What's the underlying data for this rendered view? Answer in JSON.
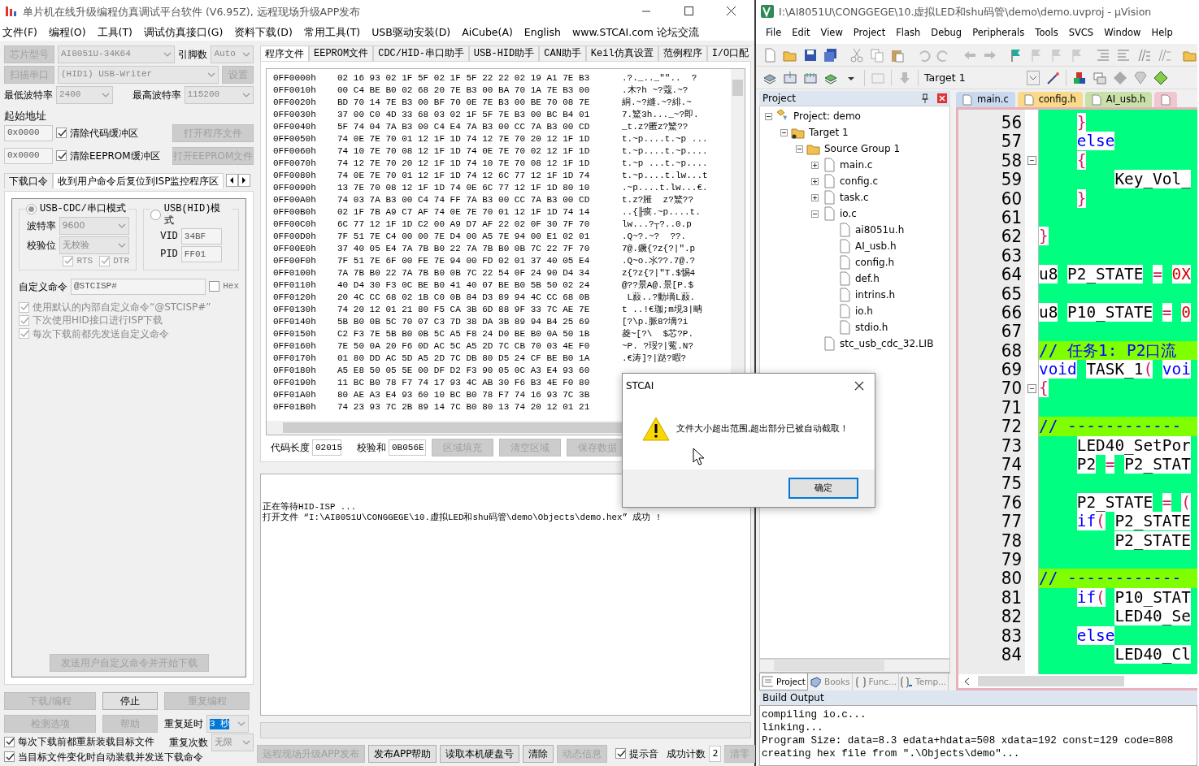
{
  "stc_window": {
    "title": "单片机在线升级编程仿真调试平台软件 (V6.95Z), 远程现场升级APP发布",
    "menu": [
      "文件(F)",
      "编程(O)",
      "工具(T)",
      "调试仿真接口(G)",
      "资料下载(D)",
      "常用工具(T)",
      "USB驱动安装(D)",
      "AiCube(A)",
      "English",
      "www.STCAI.com 论坛交流"
    ],
    "chip": {
      "button": "芯片型号",
      "value": "AI8051U-34K64",
      "pins_label": "引脚数",
      "pins_value": "Auto"
    },
    "port": {
      "button": "扫描串口",
      "value": "(HID1) USB-Writer",
      "settings_button": "设置"
    },
    "baud": {
      "min_label": "最低波特率",
      "min_value": "2400",
      "max_label": "最高波特率",
      "max_value": "115200"
    },
    "start_address_label": "起始地址",
    "address_rows": [
      {
        "value": "0x0000",
        "checkbox": "清除代码缓冲区",
        "checked": true,
        "button": "打开程序文件"
      },
      {
        "value": "0x0000",
        "checkbox": "清除EEPROM缓冲区",
        "checked": true,
        "button": "打开EEPROM文件"
      }
    ],
    "option_tabs": [
      {
        "label": "下载口令",
        "selected": false
      },
      {
        "label": "收到用户命令后复位到ISP监控程序区",
        "selected": true
      }
    ],
    "modes": [
      {
        "label": "USB-CDC/串口模式",
        "selected": true,
        "fields": [
          {
            "label": "波特率",
            "value": "9600",
            "kind": "dropdown"
          },
          {
            "label": "校验位",
            "value": "无校验",
            "kind": "dropdown"
          }
        ],
        "checks": [
          {
            "label": "RTS",
            "checked": true
          },
          {
            "label": "DTR",
            "checked": true
          }
        ]
      },
      {
        "label": "USB(HID)模式",
        "selected": false,
        "fields": [
          {
            "label": "VID",
            "value": "34BF",
            "kind": "text"
          },
          {
            "label": "PID",
            "value": "FF01",
            "kind": "text"
          }
        ]
      }
    ],
    "custom_command": {
      "label": "自定义命令",
      "value": "@STCISP#",
      "hex_label": "Hex",
      "hex_checked": false
    },
    "options": [
      {
        "label": "使用默认的内部自定义命令“@STCISP#”",
        "checked": true
      },
      {
        "label": "下次使用HID接口进行ISP下载",
        "checked": true
      },
      {
        "label": "每次下载前都先发送自定义命令",
        "checked": true
      }
    ],
    "send_button": "发送用户自定义命令并开始下载",
    "action_buttons": [
      {
        "label": "下载/编程",
        "disabled": true
      },
      {
        "label": "停止",
        "disabled": false
      },
      {
        "label": "重复编程",
        "disabled": true
      },
      {
        "label": "检测选项",
        "disabled": true
      },
      {
        "label": "帮助",
        "disabled": true
      }
    ],
    "repeat_delay": {
      "label": "重复延时",
      "value": "3 秒"
    },
    "repeat_count": {
      "label": "重复次数",
      "value": "无限"
    },
    "reload_options": [
      {
        "label": "每次下载前都重新装载目标文件",
        "checked": true
      },
      {
        "label": "当目标文件变化时自动装载并发送下载命令",
        "checked": true
      }
    ],
    "file_tabs": [
      {
        "label": "程序文件",
        "selected": true
      },
      {
        "label": "EEPROM文件",
        "selected": false
      },
      {
        "label": "CDC/HID-串口助手",
        "selected": false
      },
      {
        "label": "USB-HID助手",
        "selected": false
      },
      {
        "label": "CAN助手",
        "selected": false
      },
      {
        "label": "Keil仿真设置",
        "selected": false
      },
      {
        "label": "范例程序",
        "selected": false
      },
      {
        "label": "I/O口配",
        "selected": false
      }
    ],
    "hex_rows": [
      {
        "address": "0FF0000h",
        "bytes": "02 16 93 02 1F 5F 02 1F 5F 22 22 02 19 A1 7E B3",
        "ascii": ".?._.._\"\"..  ?"
      },
      {
        "address": "0FF0010h",
        "bytes": "00 C4 BE B0 02 68 20 7E B3 00 BA 70 1A 7E B3 00",
        "ascii": ".木?h ~?蔻.~?"
      },
      {
        "address": "0FF0020h",
        "bytes": "BD 70 14 7E B3 00 BF 70 0E 7E B3 00 BE 70 08 7E",
        "ascii": "絧.~?縫.~?緋.~"
      },
      {
        "address": "0FF0030h",
        "bytes": "37 00 C0 4D 33 68 03 02 1F 5F 7E B3 00 BC B4 01",
        "ascii": "7.鰵3h..._~?即."
      },
      {
        "address": "0FF0040h",
        "bytes": "5F 74 04 7A B3 00 C4 E4 7A B3 00 CC 7A B3 00 CD",
        "ascii": "_t.z?匿z?鰵??"
      },
      {
        "address": "0FF0050h",
        "bytes": "74 0E 7E 70 01 12 1F 1D 74 12 7E 70 20 12 1F 1D",
        "ascii": "t.~p....t.~p ..."
      },
      {
        "address": "0FF0060h",
        "bytes": "74 10 7E 70 08 12 1F 1D 74 0E 7E 70 02 12 1F 1D",
        "ascii": "t.~p....t.~p...."
      },
      {
        "address": "0FF0070h",
        "bytes": "74 12 7E 70 20 12 1F 1D 74 10 7E 70 08 12 1F 1D",
        "ascii": "t.~p ...t.~p...."
      },
      {
        "address": "0FF0080h",
        "bytes": "74 0E 7E 70 01 12 1F 1D 74 12 6C 77 12 1F 1D 74",
        "ascii": "t.~p....t.lw...t"
      },
      {
        "address": "0FF0090h",
        "bytes": "13 7E 70 08 12 1F 1D 74 0E 6C 77 12 1F 1D 80 10",
        "ascii": ".~p....t.lw...€."
      },
      {
        "address": "0FF00A0h",
        "bytes": "74 03 7A B3 00 C4 74 FF 7A B3 00 CC 7A B3 00 CD",
        "ascii": "t.z?膗  z?鰵??"
      },
      {
        "address": "0FF00B0h",
        "bytes": "02 1F 7B A9 C7 AF 74 0E 7E 70 01 12 1F 1D 74 14",
        "ascii": "..{╟瘼.~p....t."
      },
      {
        "address": "0FF00C0h",
        "bytes": "6C 77 12 1F 1D C2 00 A9 D7 AF 22 02 0F 30 7F 70",
        "ascii": "lw...?┬?..0.p"
      },
      {
        "address": "0FF00D0h",
        "bytes": "7F 51 7E C4 00 00 7E D4 00 A5 7E 94 00 E1 02 01",
        "ascii": ".Q~?.~?  ??."
      },
      {
        "address": "0FF00E0h",
        "bytes": "37 40 05 E4 7A 7B B0 22 7A 7B B0 0B 7C 22 7F 70",
        "ascii": "7@.鐝{?z{?|\".p"
      },
      {
        "address": "0FF00F0h",
        "bytes": "7F 51 7E 6F 00 FE 7E 94 00 FD 02 01 37 40 05 E4",
        "ascii": ".Q~o.氺??.7@.?"
      },
      {
        "address": "0FF0100h",
        "bytes": "7A 7B B0 22 7A 7B B0 0B 7C 22 54 0F 24 90 D4 34",
        "ascii": "z{?z{?|\"T.$惕4"
      },
      {
        "address": "0FF0110h",
        "bytes": "40 D4 30 F3 0C BE B0 41 40 07 BE B0 5B 50 02 24",
        "ascii": "@??景A@.景[P.$"
      },
      {
        "address": "0FF0120h",
        "bytes": "20 4C CC 68 02 1B C0 0B 84 D3 89 94 4C CC 68 0B",
        "ascii": " L蔱..?動墑L蔱."
      },
      {
        "address": "0FF0130h",
        "bytes": "74 20 12 01 21 80 F5 CA 3B 6D 88 9F 33 7C AE 7E",
        "ascii": "t ..!€珈;m垷3|畘"
      },
      {
        "address": "0FF0140h",
        "bytes": "5B B0 0B 5C 70 07 C3 7D 38 DA 3B 89 94 B4 25 69",
        "ascii": "[?\\p.脈8?墑?i"
      },
      {
        "address": "0FF0150h",
        "bytes": "C2 F3 7E 5B B0 0B 5C A5 F8 24 D0 BE B0 0A 50 1B",
        "ascii": "菱~[?\\  $芯?P."
      },
      {
        "address": "0FF0160h",
        "bytes": "7E 50 0A 20 F6 0D AC 5C A5 2D 7C CB 70 03 4E F0",
        "ascii": "~P. ?琝?|蒬.N?"
      },
      {
        "address": "0FF0170h",
        "bytes": "01 80 DD AC 5D A5 2D 7C DB 80 D5 24 CF BE B0 1A",
        "ascii": ".€涛]?|跶?暇?"
      },
      {
        "address": "0FF0180h",
        "bytes": "A5 E8 50 05 5E 00 DF D2 F3 90 05 0C A3 E4 93 60"
      },
      {
        "address": "0FF0190h",
        "bytes": "11 BC B0 78 F7 74 17 93 4C AB 30 F6 B3 4E F0 80"
      },
      {
        "address": "0FF01A0h",
        "bytes": "80 AE A3 E4 93 60 10 BC B0 78 F7 74 16 93 7C 3B"
      },
      {
        "address": "0FF01B0h",
        "bytes": "74 23 93 7C 2B 89 14 7C B0 80 13 74 20 12 01 21"
      }
    ],
    "code_length": {
      "label": "代码长度",
      "value": "02015"
    },
    "checksum": {
      "label": "校验和",
      "value": "0B056E"
    },
    "hex_buttons": [
      {
        "label": "区域填充",
        "disabled": true
      },
      {
        "label": "清空区域",
        "disabled": true
      },
      {
        "label": "保存数据",
        "disabled": true
      }
    ],
    "log": [
      "正在等待HID-ISP ...",
      "打开文件 “I:\\AI8051U\\CONGGEGE\\10.虚拟LED和shu码管\\demo\\Objects\\demo.hex” 成功 !"
    ],
    "bottom_buttons": [
      {
        "label": "远程现场升级APP发布",
        "disabled": true
      },
      {
        "label": "发布APP帮助",
        "disabled": false
      },
      {
        "label": "读取本机硬盘号",
        "disabled": false
      },
      {
        "label": "清除",
        "disabled": false
      },
      {
        "label": "动态信息",
        "disabled": true
      }
    ],
    "beep": {
      "label": "提示音",
      "checked": true
    },
    "success_count": {
      "label": "成功计数",
      "value": "2"
    },
    "reset_button": {
      "label": "清零",
      "disabled": true
    }
  },
  "dialog": {
    "title": "STCAI",
    "message": "文件大小超出范围,超出部分已被自动截取！",
    "button": "确定"
  },
  "uvision": {
    "title": "I:\\AI8051U\\CONGGEGE\\10.虚拟LED和shu码管\\demo\\demo.uvproj - µVision",
    "menu": [
      "File",
      "Edit",
      "View",
      "Project",
      "Flash",
      "Debug",
      "Peripherals",
      "Tools",
      "SVCS",
      "Window",
      "Help"
    ],
    "target": "Target 1",
    "project_panel": {
      "title": "Project",
      "tree": [
        {
          "label": "Project: demo",
          "kind": "project",
          "expanded": true,
          "children": [
            {
              "label": "Target 1",
              "kind": "target",
              "expanded": true,
              "children": [
                {
                  "label": "Source Group 1",
                  "kind": "group",
                  "expanded": true,
                  "children": [
                    {
                      "label": "main.c",
                      "kind": "file",
                      "expanded": false
                    },
                    {
                      "label": "config.c",
                      "kind": "file",
                      "expanded": false
                    },
                    {
                      "label": "task.c",
                      "kind": "file",
                      "expanded": false
                    },
                    {
                      "label": "io.c",
                      "kind": "file",
                      "expanded": true,
                      "children": [
                        {
                          "label": "ai8051u.h",
                          "kind": "file"
                        },
                        {
                          "label": "AI_usb.h",
                          "kind": "file"
                        },
                        {
                          "label": "config.h",
                          "kind": "file"
                        },
                        {
                          "label": "def.h",
                          "kind": "file"
                        },
                        {
                          "label": "intrins.h",
                          "kind": "file"
                        },
                        {
                          "label": "io.h",
                          "kind": "file"
                        },
                        {
                          "label": "stdio.h",
                          "kind": "file"
                        }
                      ]
                    },
                    {
                      "label": "stc_usb_cdc_32.LIB",
                      "kind": "file"
                    }
                  ]
                }
              ]
            }
          ]
        }
      ],
      "tabs": [
        {
          "label": "Project",
          "selected": true
        },
        {
          "label": "Books",
          "selected": false
        },
        {
          "label": "Func...",
          "selected": false
        },
        {
          "label": "Temp...",
          "selected": false
        }
      ]
    },
    "editor_tabs": [
      {
        "label": "main.c",
        "color": "#c9d9ef"
      },
      {
        "label": "config.h",
        "color": "#fbd98a"
      },
      {
        "label": "AI_usb.h",
        "color": "#c9e0a8"
      },
      {
        "color": "#f2c6cf"
      }
    ],
    "code_lines": [
      {
        "number": "56",
        "kind": "code",
        "tokens": [
          {
            "text": "    }",
            "kind": "brace"
          }
        ]
      },
      {
        "number": "57",
        "kind": "code",
        "tokens": [
          {
            "text": "    else",
            "kind": "keyword"
          }
        ]
      },
      {
        "number": "58",
        "kind": "code",
        "fold": true,
        "tokens": [
          {
            "text": "    {",
            "kind": "brace"
          }
        ]
      },
      {
        "number": "59",
        "kind": "code",
        "tokens": [
          {
            "text": "        Key_Vol_",
            "kind": "ident"
          }
        ]
      },
      {
        "number": "60",
        "kind": "code",
        "tokens": [
          {
            "text": "    }",
            "kind": "brace"
          }
        ]
      },
      {
        "number": "61",
        "kind": "code"
      },
      {
        "number": "62",
        "kind": "code",
        "tokens": [
          {
            "text": "}",
            "kind": "brace"
          }
        ]
      },
      {
        "number": "63",
        "kind": "code"
      },
      {
        "number": "64",
        "kind": "code",
        "tokens": [
          {
            "text": "u8",
            "kind": "ident"
          },
          {
            "text": " P2_STATE",
            "kind": "ident"
          },
          {
            "text": " =",
            "kind": "op"
          },
          {
            "text": " 0X",
            "kind": "number"
          }
        ]
      },
      {
        "number": "65",
        "kind": "code"
      },
      {
        "number": "66",
        "kind": "code",
        "tokens": [
          {
            "text": "u8",
            "kind": "ident"
          },
          {
            "text": " P10_STATE",
            "kind": "ident"
          },
          {
            "text": " =",
            "kind": "op"
          },
          {
            "text": " 0",
            "kind": "number"
          }
        ]
      },
      {
        "number": "67",
        "kind": "code"
      },
      {
        "number": "68",
        "kind": "comment",
        "tokens": [
          {
            "text": "// 任务1: P2口流",
            "kind": "comment"
          }
        ]
      },
      {
        "number": "69",
        "kind": "code",
        "tokens": [
          {
            "text": "void",
            "kind": "keyword"
          },
          {
            "text": " TASK_1",
            "kind": "ident"
          },
          {
            "text": "(",
            "kind": "brace"
          },
          {
            "text": " voi",
            "kind": "keyword"
          }
        ]
      },
      {
        "number": "70",
        "kind": "code",
        "fold": true,
        "tokens": [
          {
            "text": "{",
            "kind": "brace"
          }
        ]
      },
      {
        "number": "71",
        "kind": "code"
      },
      {
        "number": "72",
        "kind": "comment",
        "tokens": [
          {
            "text": "// ------------",
            "kind": "comment"
          }
        ]
      },
      {
        "number": "73",
        "kind": "code",
        "tokens": [
          {
            "text": "    LED40_SetPor",
            "kind": "ident"
          }
        ]
      },
      {
        "number": "74",
        "kind": "code",
        "tokens": [
          {
            "text": "    P2",
            "kind": "ident"
          },
          {
            "text": " =",
            "kind": "op"
          },
          {
            "text": " P2_STAT",
            "kind": "ident"
          }
        ]
      },
      {
        "number": "75",
        "kind": "code"
      },
      {
        "number": "76",
        "kind": "code",
        "tokens": [
          {
            "text": "    P2_STATE",
            "kind": "ident"
          },
          {
            "text": " =",
            "kind": "op"
          },
          {
            "text": " (",
            "kind": "brace"
          }
        ]
      },
      {
        "number": "77",
        "kind": "code",
        "tokens": [
          {
            "text": "    if",
            "kind": "keyword"
          },
          {
            "text": "(",
            "kind": "brace"
          },
          {
            "text": " P2_STATE",
            "kind": "ident"
          }
        ]
      },
      {
        "number": "78",
        "kind": "code",
        "tokens": [
          {
            "text": "        P2_STATE",
            "kind": "ident"
          }
        ]
      },
      {
        "number": "79",
        "kind": "code"
      },
      {
        "number": "80",
        "kind": "comment",
        "tokens": [
          {
            "text": "// ------------",
            "kind": "comment"
          }
        ]
      },
      {
        "number": "81",
        "kind": "code",
        "tokens": [
          {
            "text": "    if",
            "kind": "keyword"
          },
          {
            "text": "(",
            "kind": "brace"
          },
          {
            "text": " P10_STAT",
            "kind": "ident"
          }
        ]
      },
      {
        "number": "82",
        "kind": "code",
        "tokens": [
          {
            "text": "        LED40_Se",
            "kind": "ident"
          }
        ]
      },
      {
        "number": "83",
        "kind": "code",
        "tokens": [
          {
            "text": "    else",
            "kind": "keyword"
          }
        ]
      },
      {
        "number": "84",
        "kind": "code",
        "tokens": [
          {
            "text": "        LED40_Cl",
            "kind": "ident"
          }
        ]
      }
    ],
    "build_output": {
      "title": "Build Output",
      "lines": [
        "compiling io.c...",
        "linking...",
        "Program Size: data=8.3 edata+hdata=508 xdata=192 const=129 code=808",
        "creating hex file from \".\\Objects\\demo\"..."
      ]
    }
  }
}
